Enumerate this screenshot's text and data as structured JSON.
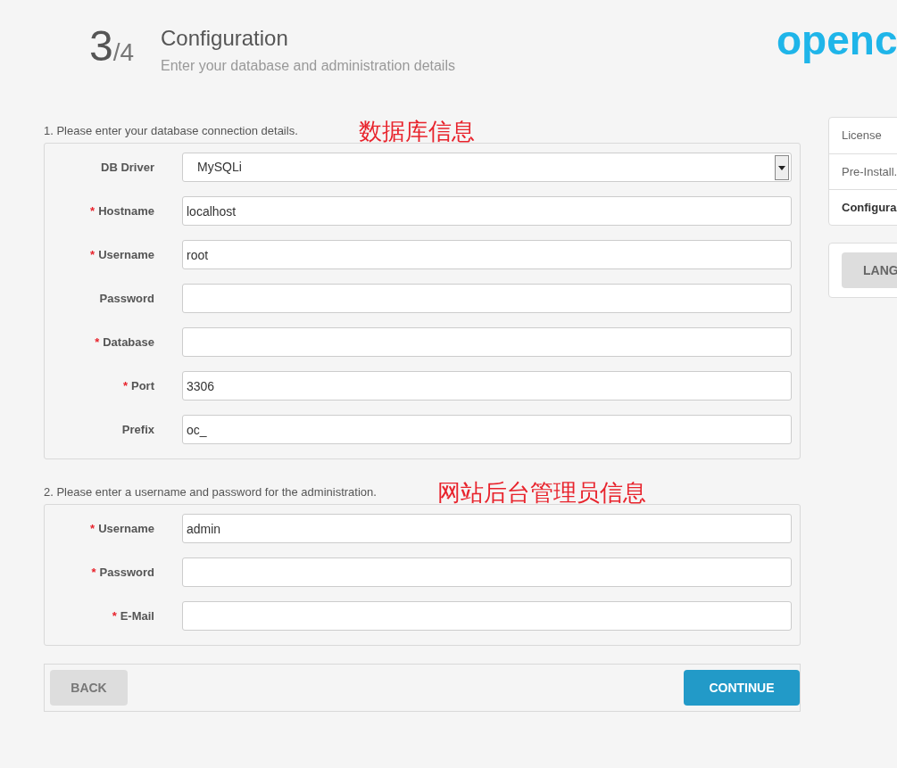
{
  "header": {
    "step": "3",
    "total": "/4",
    "title": "Configuration",
    "subtitle": "Enter your database and administration details",
    "logo": "openc"
  },
  "sections": [
    {
      "heading": "1. Please enter your database connection details.",
      "annotation": "数据库信息",
      "fields": [
        {
          "kind": "select",
          "label": "DB Driver",
          "value": "MySQLi"
        },
        {
          "kind": "text",
          "label": "Hostname",
          "required_mark": "*",
          "value": "localhost"
        },
        {
          "kind": "text",
          "label": "Username",
          "required_mark": "*",
          "value": "root"
        },
        {
          "kind": "text",
          "label": "Password"
        },
        {
          "kind": "text",
          "label": "Database",
          "required_mark": "*"
        },
        {
          "kind": "text",
          "label": "Port",
          "required_mark": "*",
          "value": "3306"
        },
        {
          "kind": "text",
          "label": "Prefix",
          "value": "oc_"
        }
      ]
    },
    {
      "heading": "2. Please enter a username and password for the administration.",
      "annotation": "网站后台管理员信息",
      "fields": [
        {
          "kind": "text",
          "label": "Username",
          "required_mark": "*",
          "value": "admin"
        },
        {
          "kind": "text",
          "label": "Password",
          "required_mark": "*"
        },
        {
          "kind": "text",
          "label": "E-Mail",
          "required_mark": "*"
        }
      ]
    }
  ],
  "buttons": {
    "back": "BACK",
    "continue": "CONTINUE"
  },
  "sidebar": {
    "steps": [
      {
        "label": "License",
        "selected": false
      },
      {
        "label": "Pre-Install.",
        "selected": false
      },
      {
        "label": "Configura",
        "selected": true
      }
    ],
    "language_button": "LANG"
  }
}
